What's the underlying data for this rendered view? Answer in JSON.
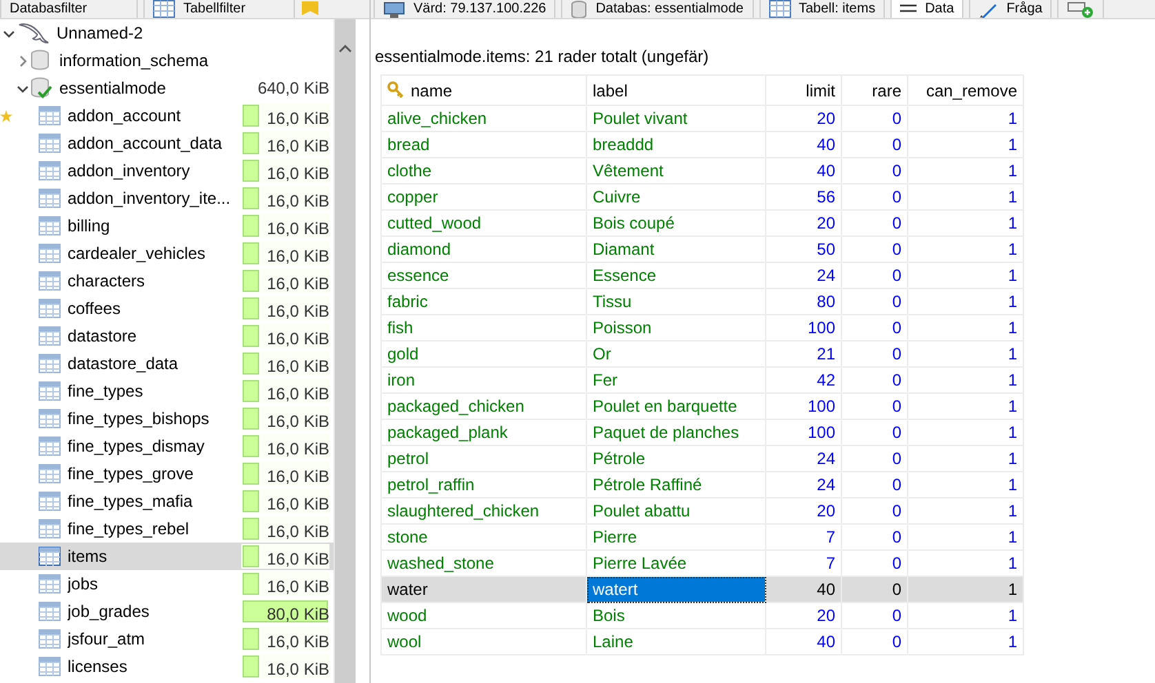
{
  "left_tabs": [
    {
      "label": "Databasfilter",
      "selected": false
    },
    {
      "label": "Tabellfilter",
      "selected": false
    }
  ],
  "main_tabs": [
    {
      "label": "Värd: 79.137.100.226",
      "kind": "host",
      "selected": false
    },
    {
      "label": "Databas: essentialmode",
      "kind": "database",
      "selected": false
    },
    {
      "label": "Tabell: items",
      "kind": "table",
      "selected": false
    },
    {
      "label": "Data",
      "kind": "data",
      "selected": true
    },
    {
      "label": "Fråga",
      "kind": "query",
      "selected": false
    },
    {
      "kind": "new",
      "selected": false
    }
  ],
  "tree": [
    {
      "name": "Unnamed-2",
      "kind": "host",
      "expanded": true,
      "children": [
        {
          "name": "information_schema",
          "kind": "database",
          "expanded": false,
          "active": false
        },
        {
          "name": "essentialmode",
          "kind": "database",
          "expanded": true,
          "active": true,
          "size": "640,0 KiB",
          "children": [
            {
              "name": "addon_account",
              "kind": "table",
              "size": "16,0 KiB",
              "level": 0.2,
              "selected": false,
              "starred": true
            },
            {
              "name": "addon_account_data",
              "kind": "table",
              "size": "16,0 KiB",
              "level": 0.2,
              "selected": false,
              "starred": false
            },
            {
              "name": "addon_inventory",
              "kind": "table",
              "size": "16,0 KiB",
              "level": 0.2,
              "selected": false,
              "starred": false
            },
            {
              "name": "addon_inventory_ite...",
              "kind": "table",
              "size": "16,0 KiB",
              "level": 0.2,
              "selected": false,
              "starred": false
            },
            {
              "name": "billing",
              "kind": "table",
              "size": "16,0 KiB",
              "level": 0.2,
              "selected": false,
              "starred": false
            },
            {
              "name": "cardealer_vehicles",
              "kind": "table",
              "size": "16,0 KiB",
              "level": 0.2,
              "selected": false,
              "starred": false
            },
            {
              "name": "characters",
              "kind": "table",
              "size": "16,0 KiB",
              "level": 0.2,
              "selected": false,
              "starred": false
            },
            {
              "name": "coffees",
              "kind": "table",
              "size": "16,0 KiB",
              "level": 0.2,
              "selected": false,
              "starred": false
            },
            {
              "name": "datastore",
              "kind": "table",
              "size": "16,0 KiB",
              "level": 0.2,
              "selected": false,
              "starred": false
            },
            {
              "name": "datastore_data",
              "kind": "table",
              "size": "16,0 KiB",
              "level": 0.2,
              "selected": false,
              "starred": false
            },
            {
              "name": "fine_types",
              "kind": "table",
              "size": "16,0 KiB",
              "level": 0.2,
              "selected": false,
              "starred": false
            },
            {
              "name": "fine_types_bishops",
              "kind": "table",
              "size": "16,0 KiB",
              "level": 0.2,
              "selected": false,
              "starred": false
            },
            {
              "name": "fine_types_dismay",
              "kind": "table",
              "size": "16,0 KiB",
              "level": 0.2,
              "selected": false,
              "starred": false
            },
            {
              "name": "fine_types_grove",
              "kind": "table",
              "size": "16,0 KiB",
              "level": 0.2,
              "selected": false,
              "starred": false
            },
            {
              "name": "fine_types_mafia",
              "kind": "table",
              "size": "16,0 KiB",
              "level": 0.2,
              "selected": false,
              "starred": false
            },
            {
              "name": "fine_types_rebel",
              "kind": "table",
              "size": "16,0 KiB",
              "level": 0.2,
              "selected": false,
              "starred": false
            },
            {
              "name": "items",
              "kind": "table",
              "size": "16,0 KiB",
              "level": 0.2,
              "selected": true,
              "starred": false
            },
            {
              "name": "jobs",
              "kind": "table",
              "size": "16,0 KiB",
              "level": 0.2,
              "selected": false,
              "starred": false
            },
            {
              "name": "job_grades",
              "kind": "table",
              "size": "80,0 KiB",
              "level": 1,
              "selected": false,
              "starred": false
            },
            {
              "name": "jsfour_atm",
              "kind": "table",
              "size": "16,0 KiB",
              "level": 0.2,
              "selected": false,
              "starred": false
            },
            {
              "name": "licenses",
              "kind": "table",
              "size": "16,0 KiB",
              "level": 0.2,
              "selected": false,
              "starred": false
            }
          ]
        }
      ]
    }
  ],
  "grid": {
    "title": "essentialmode.items: 21 rader totalt (ungefär)",
    "columns": [
      {
        "name": "name",
        "kind": "key",
        "focused": false
      },
      {
        "name": "label",
        "kind": "text",
        "focused": true
      },
      {
        "name": "limit",
        "kind": "number",
        "focused": false
      },
      {
        "name": "rare",
        "kind": "number",
        "focused": false
      },
      {
        "name": "can_remove",
        "kind": "number",
        "focused": false
      }
    ],
    "rows": [
      {
        "cells": [
          "alive_chicken",
          "Poulet vivant",
          "20",
          "0",
          "1"
        ],
        "selected": false
      },
      {
        "cells": [
          "bread",
          "breaddd",
          "40",
          "0",
          "1"
        ],
        "selected": false
      },
      {
        "cells": [
          "clothe",
          "Vêtement",
          "40",
          "0",
          "1"
        ],
        "selected": false
      },
      {
        "cells": [
          "copper",
          "Cuivre",
          "56",
          "0",
          "1"
        ],
        "selected": false
      },
      {
        "cells": [
          "cutted_wood",
          "Bois coupé",
          "20",
          "0",
          "1"
        ],
        "selected": false
      },
      {
        "cells": [
          "diamond",
          "Diamant",
          "50",
          "0",
          "1"
        ],
        "selected": false
      },
      {
        "cells": [
          "essence",
          "Essence",
          "24",
          "0",
          "1"
        ],
        "selected": false
      },
      {
        "cells": [
          "fabric",
          "Tissu",
          "80",
          "0",
          "1"
        ],
        "selected": false
      },
      {
        "cells": [
          "fish",
          "Poisson",
          "100",
          "0",
          "1"
        ],
        "selected": false
      },
      {
        "cells": [
          "gold",
          "Or",
          "21",
          "0",
          "1"
        ],
        "selected": false
      },
      {
        "cells": [
          "iron",
          "Fer",
          "42",
          "0",
          "1"
        ],
        "selected": false
      },
      {
        "cells": [
          "packaged_chicken",
          "Poulet en barquette",
          "100",
          "0",
          "1"
        ],
        "selected": false
      },
      {
        "cells": [
          "packaged_plank",
          "Paquet de planches",
          "100",
          "0",
          "1"
        ],
        "selected": false
      },
      {
        "cells": [
          "petrol",
          "Pétrole",
          "24",
          "0",
          "1"
        ],
        "selected": false
      },
      {
        "cells": [
          "petrol_raffin",
          "Pétrole Raffiné",
          "24",
          "0",
          "1"
        ],
        "selected": false
      },
      {
        "cells": [
          "slaughtered_chicken",
          "Poulet abattu",
          "20",
          "0",
          "1"
        ],
        "selected": false
      },
      {
        "cells": [
          "stone",
          "Pierre",
          "7",
          "0",
          "1"
        ],
        "selected": false
      },
      {
        "cells": [
          "washed_stone",
          "Pierre Lavée",
          "7",
          "0",
          "1"
        ],
        "selected": false
      },
      {
        "cells": [
          "water",
          "watert",
          "40",
          "0",
          "1"
        ],
        "selected": true
      },
      {
        "cells": [
          "wood",
          "Bois",
          "20",
          "0",
          "1"
        ],
        "selected": false
      },
      {
        "cells": [
          "wool",
          "Laine",
          "40",
          "0",
          "1"
        ],
        "selected": false
      }
    ]
  }
}
